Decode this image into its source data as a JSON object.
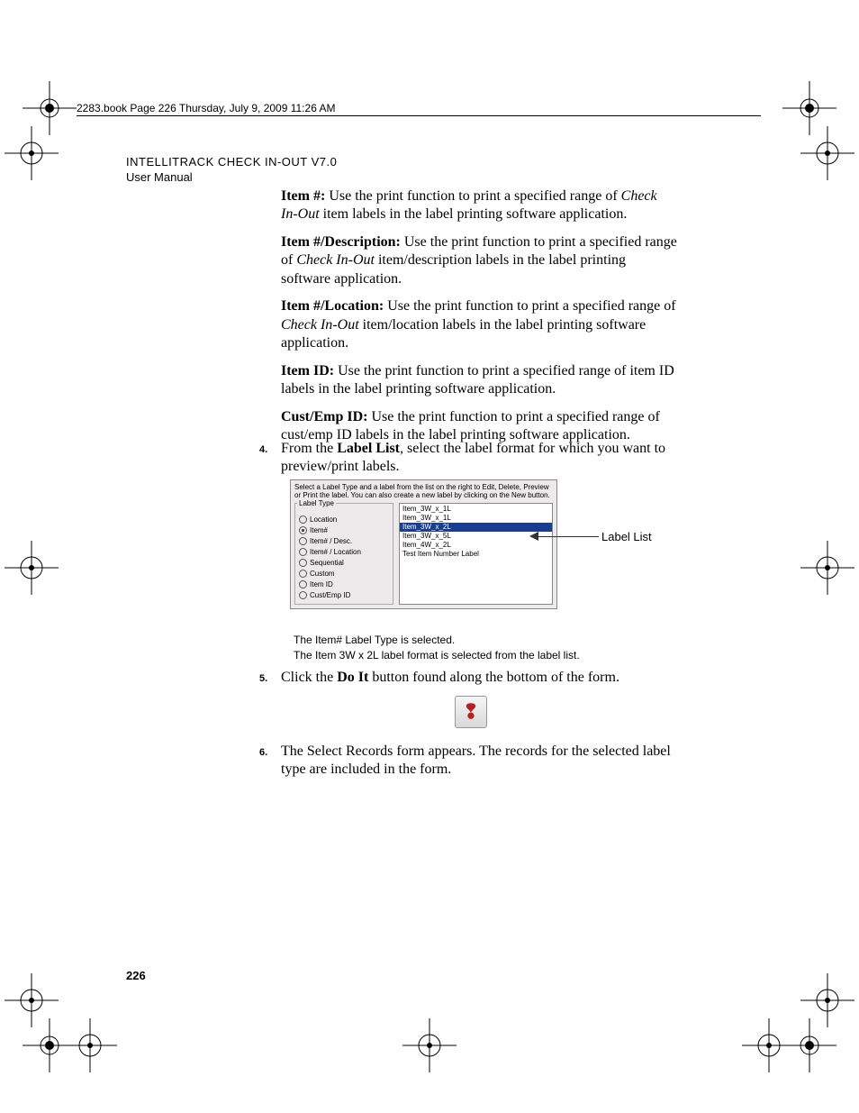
{
  "header": {
    "line": "2283.book  Page 226  Thursday, July 9, 2009  11:26 AM"
  },
  "doc": {
    "title": "INTELLITRACK CHECK IN-OUT V7.0",
    "subtitle": "User Manual"
  },
  "paras": {
    "p1_lead": "Item #:",
    "p1_a": " Use the print function to print a specified range of ",
    "p1_it": "Check In-Out",
    "p1_b": " item labels in the label printing software application.",
    "p2_lead": "Item #/Description:",
    "p2_a": " Use the print function to print a specified range of ",
    "p2_it": "Check In-Out",
    "p2_b": " item/description labels in the label printing software application.",
    "p3_lead": "Item #/Location:",
    "p3_a": " Use the print function to print a specified range of ",
    "p3_it": "Check In-Out",
    "p3_b": " item/location labels in the label printing software application.",
    "p4_lead": "Item ID:",
    "p4_a": " Use the print function to print a specified range of item ID labels in the label printing software application.",
    "p5_lead": "Cust/Emp ID:",
    "p5_a": " Use the print function to print a specified range of cust/emp ID labels in the label printing software application."
  },
  "steps": {
    "s4_num": "4.",
    "s4_a": "From the ",
    "s4_bold": "Label List",
    "s4_b": ", select the label format for which you want to preview/print labels.",
    "s5_num": "5.",
    "s5_a": "Click the ",
    "s5_bold": "Do It",
    "s5_b": " button found along the bottom of the form.",
    "s6_num": "6.",
    "s6_a": "The Select Records form appears. The records for the selected label type are included in the form."
  },
  "figure": {
    "instruction": "Select a Label Type and a label from the list on the right to Edit, Delete, Preview or Print the label. You can also create a new label by clicking on the New button.",
    "group_title": "Label Type",
    "radios": [
      {
        "label": "Location",
        "selected": false
      },
      {
        "label": "Item#",
        "selected": true
      },
      {
        "label": "Item# / Desc.",
        "selected": false
      },
      {
        "label": "Item# / Location",
        "selected": false
      },
      {
        "label": "Sequential",
        "selected": false
      },
      {
        "label": "Custom",
        "selected": false
      },
      {
        "label": "Item ID",
        "selected": false
      },
      {
        "label": "Cust/Emp ID",
        "selected": false
      }
    ],
    "list": [
      {
        "label": "Item_3W_x_1L",
        "selected": false
      },
      {
        "label": "Item_3W_x_1L",
        "selected": false
      },
      {
        "label": "Item_3W_x_2L",
        "selected": true
      },
      {
        "label": "Item_3W_x_5L",
        "selected": false
      },
      {
        "label": "Item_4W_x_2L",
        "selected": false
      },
      {
        "label": "Test Item Number Label",
        "selected": false
      }
    ]
  },
  "callout": {
    "label": "Label List"
  },
  "captions": {
    "c1": "The Item# Label Type is selected.",
    "c2": "The Item 3W x 2L label format is selected from the label list."
  },
  "doit": {
    "glyph": "❢"
  },
  "page_number": "226"
}
